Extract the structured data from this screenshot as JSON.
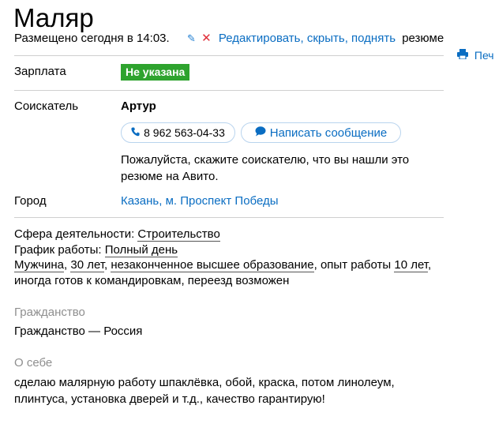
{
  "title": "Маляр",
  "meta": {
    "posted": "Размещено сегодня в 14:03.",
    "edit": "Редактировать",
    "hide": "скрыть",
    "raise": "поднять",
    "tail": "резюме",
    "comma1": ",",
    "comma2": ","
  },
  "print_label": "Печ",
  "salary": {
    "label": "Зарплата",
    "value": "Не указана",
    "badge_color": "#2ea32e"
  },
  "applicant": {
    "label": "Соискатель",
    "name": "Артур",
    "phone": "8 962 563-04-33",
    "message_button": "Написать сообщение",
    "hint": "Пожалуйста, скажите соискателю, что вы нашли это резюме на Авито."
  },
  "city": {
    "label": "Город",
    "value": "Казань, м. Проспект Победы"
  },
  "details": {
    "field_label": "Сфера деятельности:",
    "field_value": "Строительство",
    "schedule_label": "График работы:",
    "schedule_value": "Полный день",
    "gender": "Мужчина",
    "age": "30 лет",
    "education": "незаконченное высшее образование",
    "experience_prefix": "опыт работы",
    "experience": "10 лет",
    "rest": "иногда готов к командировкам, переезд возможен"
  },
  "citizenship": {
    "heading": "Гражданство",
    "text": "Гражданство — Россия"
  },
  "about": {
    "heading": "О себе",
    "text": "сделаю малярную работу шпаклёвка, обой, краска, потом линолеум, плинтуса, установка дверей и т.д., качество гарантирую!"
  },
  "colors": {
    "link": "#0a6dc2",
    "badge": "#2ea32e",
    "delete": "#e0303a",
    "muted": "#8f8f8f"
  },
  "icons": [
    "pencil-icon",
    "close-icon",
    "printer-icon",
    "phone-icon",
    "chat-icon"
  ]
}
